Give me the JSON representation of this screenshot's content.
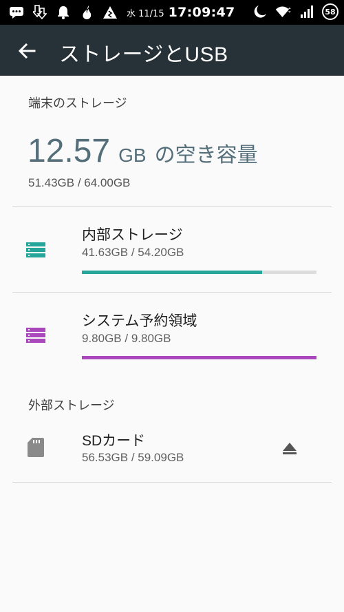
{
  "status_bar": {
    "date": "水 11/15",
    "time": "17:09:47",
    "battery": "58",
    "icons": [
      "message-icon",
      "download-icon",
      "bell-icon",
      "flame-icon",
      "warning-icon",
      "moon-icon",
      "wifi-icon",
      "signal-icon",
      "battery-icon"
    ]
  },
  "app_bar": {
    "title": "ストレージとUSB",
    "back_icon": "arrow-back-icon"
  },
  "device_storage": {
    "header": "端末のストレージ",
    "free_value": "12.57",
    "free_unit": "GB",
    "free_suffix": "の空き容量",
    "used_total": "51.43GB / 64.00GB"
  },
  "items": [
    {
      "title": "内部ストレージ",
      "usage": "41.63GB / 54.20GB",
      "fraction": 0.768,
      "color": "#26a69a",
      "icon": "storage-stack-icon"
    },
    {
      "title": "システム予約領域",
      "usage": "9.80GB / 9.80GB",
      "fraction": 1.0,
      "color": "#ab47bc",
      "icon": "storage-stack-icon"
    }
  ],
  "external_storage": {
    "header": "外部ストレージ",
    "sd": {
      "title": "SDカード",
      "usage": "56.53GB / 59.09GB",
      "icon": "sd-card-icon",
      "action_icon": "eject-icon"
    }
  }
}
